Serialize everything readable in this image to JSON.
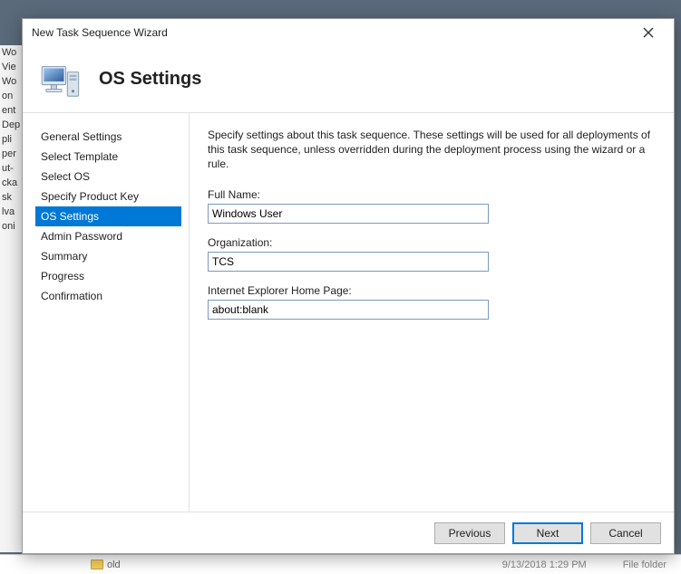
{
  "bg": {
    "strips": [
      "Wo",
      "Vie",
      "Wo",
      "on",
      "ent",
      "Dep",
      "pli",
      "per",
      "ut-",
      "cka",
      "sk",
      "lva",
      "oni"
    ],
    "folder_label": "old",
    "time": "9/13/2018 1:29 PM",
    "file_folder": "File folder"
  },
  "window": {
    "title": "New Task Sequence Wizard",
    "page_heading": "OS Settings"
  },
  "sidebar": {
    "steps": [
      {
        "label": "General Settings",
        "selected": false
      },
      {
        "label": "Select Template",
        "selected": false
      },
      {
        "label": "Select OS",
        "selected": false
      },
      {
        "label": "Specify Product Key",
        "selected": false
      },
      {
        "label": "OS Settings",
        "selected": true
      },
      {
        "label": "Admin Password",
        "selected": false
      },
      {
        "label": "Summary",
        "selected": false
      },
      {
        "label": "Progress",
        "selected": false
      },
      {
        "label": "Confirmation",
        "selected": false
      }
    ]
  },
  "main": {
    "description": "Specify settings about this task sequence.  These settings will be used for all deployments of this task sequence, unless overridden during the deployment process using the wizard or a rule.",
    "fields": {
      "full_name_label": "Full Name:",
      "full_name_value": "Windows User",
      "organization_label": "Organization:",
      "organization_value": "TCS",
      "ie_home_label": "Internet Explorer Home Page:",
      "ie_home_value": "about:blank"
    }
  },
  "footer": {
    "previous": "Previous",
    "next": "Next",
    "cancel": "Cancel"
  }
}
